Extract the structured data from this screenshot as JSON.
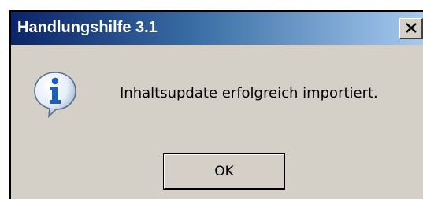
{
  "window": {
    "title": "Handlungshilfe 3.1",
    "close_label": "close"
  },
  "message": {
    "icon": "info-icon",
    "text": "Inhaltsupdate erfolgreich importiert."
  },
  "buttons": {
    "ok_label": "OK"
  },
  "colors": {
    "dialog_background": "#d4d0c8",
    "titlebar_start": "#0a246a",
    "titlebar_end": "#a6caf0",
    "title_text": "#ffffff",
    "info_icon": "#1d5fb4"
  }
}
